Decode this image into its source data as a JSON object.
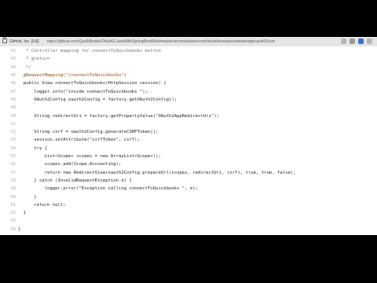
{
  "browser": {
    "org_label": "GitHub, Inc. [US]",
    "url": "https://github.com/QuickBooks/OAuth2-JavaWithSpringBoot/blob/master/src/main/java/com/intuit/developer/sampleapp/oauth2/controller/QBOController.java"
  },
  "code": {
    "lines": [
      {
        "num": "42",
        "text": "   * Controller mapping for connectToQuickbooks button"
      },
      {
        "num": "43",
        "text": "   * @return"
      },
      {
        "num": "44",
        "text": "   */"
      },
      {
        "num": "45",
        "text": "  @RequestMapping(\"/connectToQuickbooks\")"
      },
      {
        "num": "46",
        "text": "  public View connectToQuickbooks(HttpSession session) {"
      },
      {
        "num": "47",
        "text": "      logger.info(\"inside connectToQuickbooks \");"
      },
      {
        "num": "48",
        "text": "      OAuth2Config oauth2Config = factory.getOAuth2Config();"
      },
      {
        "num": "49",
        "text": ""
      },
      {
        "num": "50",
        "text": "      String redirectUri = factory.getPropertyValue(\"OAuth2AppRedirectUri\");"
      },
      {
        "num": "51",
        "text": ""
      },
      {
        "num": "52",
        "text": "      String csrf = oauth2Config.generateCSRFToken();"
      },
      {
        "num": "53",
        "text": "      session.setAttribute(\"csrfToken\", csrf);"
      },
      {
        "num": "54",
        "text": "      try {"
      },
      {
        "num": "55",
        "text": "          List<Scope> scopes = new ArrayList<Scope>();"
      },
      {
        "num": "56",
        "text": "          scopes.add(Scope.Accounting);"
      },
      {
        "num": "57",
        "text": "          return new RedirectView(oauth2Config.prepareUrl(scopes, redirectUri, csrf), true, true, false);"
      },
      {
        "num": "58",
        "text": "      } catch (InvalidRequestException e) {"
      },
      {
        "num": "59",
        "text": "          logger.error(\"Exception calling connectToQuickbooks \", e);"
      },
      {
        "num": "60",
        "text": "      }"
      },
      {
        "num": "61",
        "text": "      return null;"
      },
      {
        "num": "62",
        "text": "  }"
      },
      {
        "num": "63",
        "text": ""
      },
      {
        "num": "64",
        "text": "}"
      }
    ]
  },
  "icons": [
    "lock-icon",
    "star-icon",
    "extension-icon",
    "profile-icon",
    "menu-icon"
  ]
}
